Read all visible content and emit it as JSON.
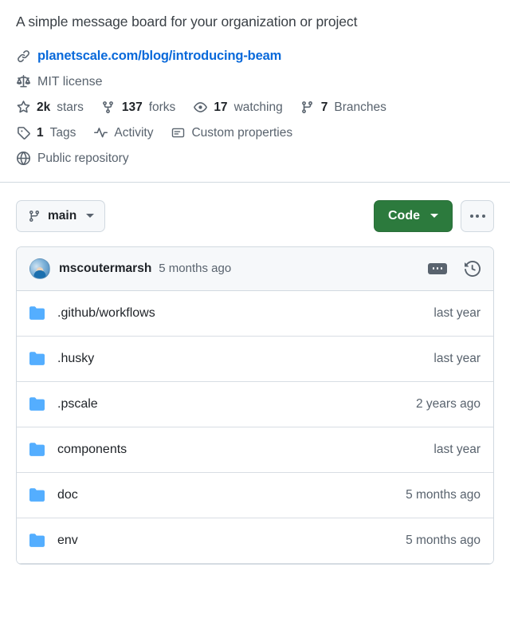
{
  "about": {
    "description": "A simple message board for your organization or project",
    "homepage": {
      "icon": "link-icon",
      "label": "planetscale.com/blog/introducing-beam"
    },
    "license": {
      "icon": "law-scale-icon",
      "label": "MIT license"
    },
    "stats": [
      {
        "icon": "star-icon",
        "count": "2k",
        "label": "stars"
      },
      {
        "icon": "fork-icon",
        "count": "137",
        "label": "forks"
      },
      {
        "icon": "eye-icon",
        "count": "17",
        "label": "watching"
      },
      {
        "icon": "branch-icon",
        "count": "7",
        "label": "Branches"
      }
    ],
    "links": [
      {
        "icon": "tag-icon",
        "count": "1",
        "label": "Tags"
      },
      {
        "icon": "pulse-icon",
        "count": "",
        "label": "Activity"
      },
      {
        "icon": "custom-properties-icon",
        "count": "",
        "label": "Custom properties"
      }
    ],
    "visibility": {
      "icon": "globe-icon",
      "label": "Public repository"
    }
  },
  "branch_bar": {
    "branch_icon": "git-branch-icon",
    "branch_name": "main",
    "code_button_label": "Code",
    "more_button_icon": "kebab-horizontal-icon"
  },
  "file_table": {
    "commit": {
      "author": "mscoutermarsh",
      "time": "5 months ago",
      "message_badge_icon": "commit-message-icon",
      "history_icon": "history-icon"
    },
    "rows": [
      {
        "icon": "folder-icon",
        "name": ".github/workflows",
        "time": "last year"
      },
      {
        "icon": "folder-icon",
        "name": ".husky",
        "time": "last year"
      },
      {
        "icon": "folder-icon",
        "name": ".pscale",
        "time": "2 years ago"
      },
      {
        "icon": "folder-icon",
        "name": "components",
        "time": "last year"
      },
      {
        "icon": "folder-icon",
        "name": "doc",
        "time": "5 months ago"
      },
      {
        "icon": "folder-icon",
        "name": "env",
        "time": "5 months ago"
      }
    ]
  },
  "colors": {
    "link": "#0969da",
    "code_green": "#2c7a3d",
    "folder_blue": "#54aeff",
    "muted_text": "#59636e",
    "border": "#d1d9e0"
  }
}
